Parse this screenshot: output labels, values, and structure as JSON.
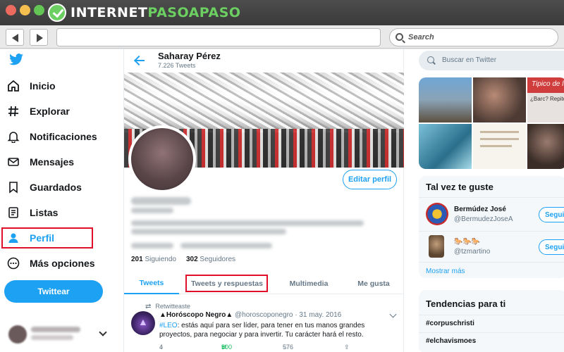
{
  "browser": {
    "brand_main": "INTERNET",
    "brand_accent": "PASOAPASO",
    "search_placeholder": "Search"
  },
  "sidebar": {
    "items": [
      {
        "label": "Inicio",
        "icon": "home-icon"
      },
      {
        "label": "Explorar",
        "icon": "hashtag-icon"
      },
      {
        "label": "Notificaciones",
        "icon": "bell-icon"
      },
      {
        "label": "Mensajes",
        "icon": "mail-icon"
      },
      {
        "label": "Guardados",
        "icon": "bookmark-icon"
      },
      {
        "label": "Listas",
        "icon": "list-icon"
      },
      {
        "label": "Perfil",
        "icon": "person-icon",
        "active": true
      },
      {
        "label": "Más opciones",
        "icon": "more-icon"
      }
    ],
    "tweet_button": "Twittear"
  },
  "profile": {
    "name": "Saharay Pérez",
    "tweet_count": "7.226 Tweets",
    "edit_button": "Editar perfil",
    "following_count": "201",
    "following_label": "Siguiendo",
    "followers_count": "302",
    "followers_label": "Seguidores",
    "tabs": [
      "Tweets",
      "Tweets y respuestas",
      "Multimedia",
      "Me gusta"
    ]
  },
  "tweet": {
    "retweet_label": "Retwitteaste",
    "author": "▲Horóscopo Negro▲",
    "handle": "@horoscoponegro",
    "date": "· 31 may. 2016",
    "hashtag": "#LEO",
    "text": ": estás aquí para ser líder, para tener en tus manos grandes proyectos, para negociar y para invertir. Tu carácter hará el resto.",
    "replies": "4",
    "retweets": "500",
    "likes": "576"
  },
  "right": {
    "search_placeholder": "Buscar en Twitter",
    "who_to_follow_title": "Tal vez te guste",
    "suggestions": [
      {
        "name": "Bermúdez José",
        "handle": "@BermudezJoseA",
        "button": "Segui"
      },
      {
        "name": "🐎🐎🐎",
        "handle": "@tzmartino",
        "button": "Segui"
      }
    ],
    "show_more": "Mostrar más",
    "trends_title": "Tendencias para ti",
    "trends": [
      "#corpuschristi",
      "#elchavismoes"
    ],
    "media_overlay_text": "Tipico de l",
    "media_caption": "¿Barc? Repite lo q"
  },
  "colors": {
    "twitter_blue": "#1da1f2",
    "highlight_red": "#e0102b",
    "retweet_green": "#17bf63"
  }
}
